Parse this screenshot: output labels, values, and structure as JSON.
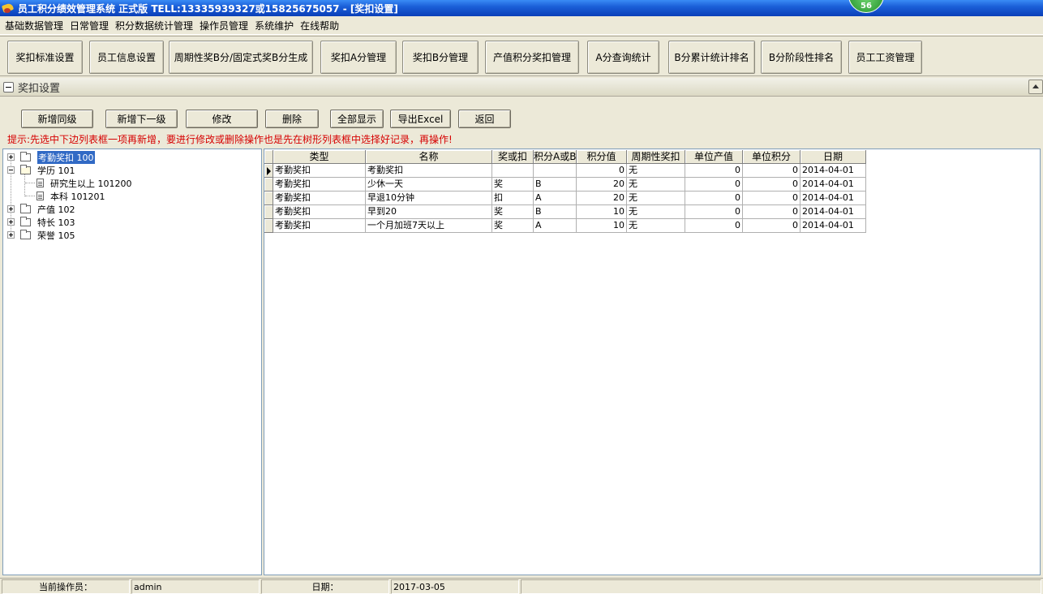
{
  "window": {
    "title": "员工积分绩效管理系统 正式版 TELL:13335939327或15825675057 - [奖扣设置]",
    "badge": "56"
  },
  "menu": [
    "基础数据管理",
    "日常管理",
    "积分数据统计管理",
    "操作员管理",
    "系统维护",
    "在线帮助"
  ],
  "toolbar": [
    "奖扣标准设置",
    "员工信息设置",
    "周期性奖B分/固定式奖B分生成",
    "奖扣A分管理",
    "奖扣B分管理",
    "产值积分奖扣管理",
    "A分查询统计",
    "B分累计统计排名",
    "B分阶段性排名",
    "员工工资管理"
  ],
  "panel": {
    "title": "奖扣设置"
  },
  "actions": [
    "新增同级",
    "新增下一级",
    "修改",
    "删除",
    "全部显示",
    "导出Excel",
    "返回"
  ],
  "hint": "提示:先选中下边列表框一项再新增，要进行修改或删除操作也是先在树形列表框中选择好记录，再操作!",
  "tree": [
    "考勤奖扣 100",
    "学历 101",
    "研究生以上 101200",
    "本科 101201",
    "产值 102",
    "特长 103",
    "荣誉 105"
  ],
  "grid": {
    "columns": [
      "类型",
      "名称",
      "奖或扣",
      "积分A或B",
      "积分值",
      "周期性奖扣",
      "单位产值",
      "单位积分",
      "日期"
    ],
    "rows": [
      [
        "考勤奖扣",
        "考勤奖扣",
        "",
        "",
        "0",
        "无",
        "0",
        "0",
        "2014-04-01"
      ],
      [
        "考勤奖扣",
        "少休一天",
        "奖",
        "B",
        "20",
        "无",
        "0",
        "0",
        "2014-04-01"
      ],
      [
        "考勤奖扣",
        "早退10分钟",
        "扣",
        "A",
        "20",
        "无",
        "0",
        "0",
        "2014-04-01"
      ],
      [
        "考勤奖扣",
        "早到20",
        "奖",
        "B",
        "10",
        "无",
        "0",
        "0",
        "2014-04-01"
      ],
      [
        "考勤奖扣",
        "一个月加班7天以上",
        "奖",
        "A",
        "10",
        "无",
        "0",
        "0",
        "2014-04-01"
      ]
    ]
  },
  "status": {
    "operator_label": "当前操作员：",
    "operator_value": "admin",
    "date_label": "日期：",
    "date_value": "2017-03-05"
  }
}
